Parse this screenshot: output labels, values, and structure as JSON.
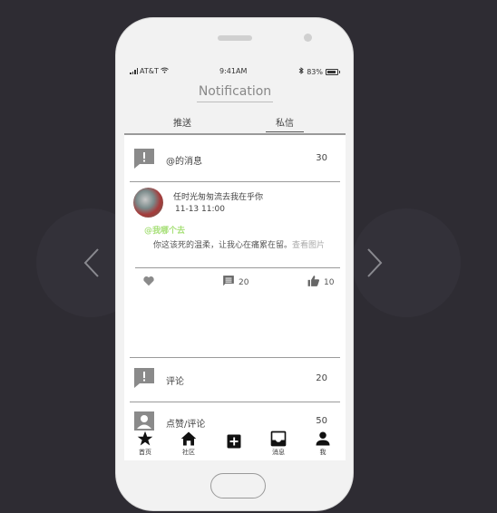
{
  "statusbar": {
    "carrier": "AT&T",
    "time": "9:41AM",
    "battery": "83%"
  },
  "header": {
    "title": "Notification"
  },
  "tabs": [
    {
      "label": "推送"
    },
    {
      "label": "私信"
    }
  ],
  "mentions": {
    "label": "@的消息",
    "count": "30"
  },
  "post": {
    "author": "任时光匆匆流去我在乎你",
    "date": "11-13 11:00",
    "mention": "@我哪个去",
    "body": "你这该死的温柔，让我心在痛累在留。",
    "more": "查看图片",
    "comments": "20",
    "likes": "10"
  },
  "comments_row": {
    "label": "评论",
    "count": "20"
  },
  "likes_row": {
    "label": "点赞/评论",
    "count": "50"
  },
  "bottom_nav": [
    {
      "label": "首页",
      "icon": "star-icon"
    },
    {
      "label": "社区",
      "icon": "home-icon"
    },
    {
      "label": "",
      "icon": "add-icon"
    },
    {
      "label": "消息",
      "icon": "inbox-icon"
    },
    {
      "label": "我",
      "icon": "person-icon"
    }
  ],
  "colors": {
    "background": "#2e2c33",
    "mention": "#a8e07a",
    "icon": "#8a8a8a"
  }
}
